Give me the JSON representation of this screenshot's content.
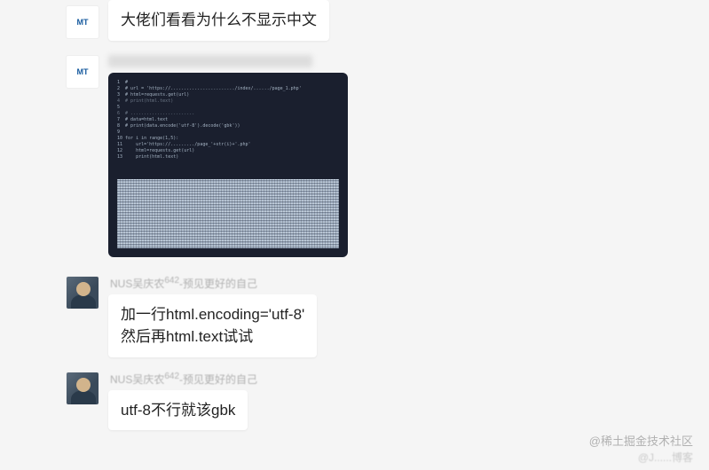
{
  "messages": [
    {
      "avatar_type": "logo",
      "avatar_text": "MT",
      "text": "大佬们看看为什么不显示中文"
    },
    {
      "avatar_type": "logo",
      "avatar_text": "MT",
      "image": true
    },
    {
      "avatar_type": "photo",
      "nickname_prefix": "NUS吴庆农",
      "nickname_sup": "642",
      "nickname_suffix": "-预见更好的自己",
      "text": "加一行html.encoding='utf-8'\n然后再html.text试试"
    },
    {
      "avatar_type": "photo",
      "nickname_prefix": "NUS吴庆农",
      "nickname_sup": "642",
      "nickname_suffix": "-预见更好的自己",
      "text": "utf-8不行就该gbk"
    }
  ],
  "code_preview": [
    "1  #",
    "2  # url = 'https://......................../index/....../page_1.php'",
    "3  # html=requests.get(url)",
    "4  # print(html.text)",
    "5  ",
    "6  # ........................",
    "7  # data=html.text",
    "8  # print(data.encode('utf-8').decode('gbk'))",
    "9  ",
    "10 for i in range(1,5):",
    "11     url='https://........./page_'+str(i)+'.php'",
    "12     html=requests.get(url)",
    "13     print(html.text)"
  ],
  "watermarks": {
    "primary": "@稀土掘金技术社区",
    "secondary": "@J......博客"
  }
}
